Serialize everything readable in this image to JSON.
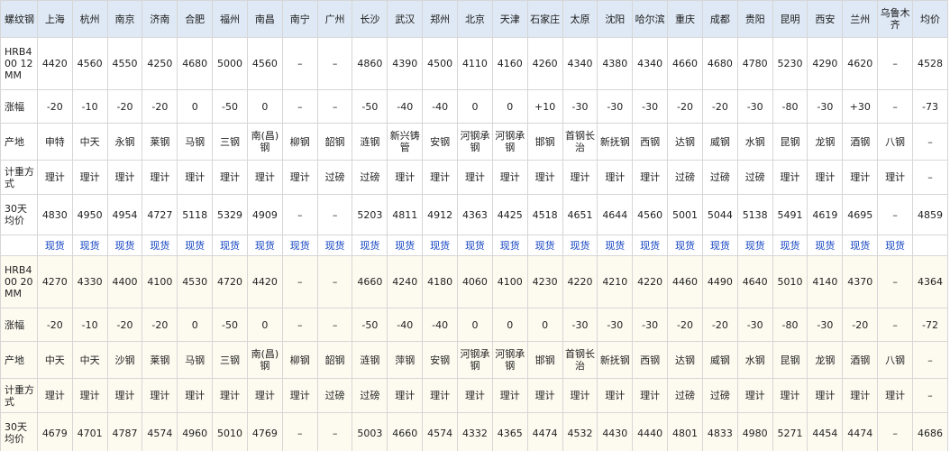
{
  "header": {
    "corner": "螺纹钢",
    "cities": [
      "上海",
      "杭州",
      "南京",
      "济南",
      "合肥",
      "福州",
      "南昌",
      "南宁",
      "广州",
      "长沙",
      "武汉",
      "郑州",
      "北京",
      "天津",
      "石家庄",
      "太原",
      "沈阳",
      "哈尔滨",
      "重庆",
      "成都",
      "贵阳",
      "昆明",
      "西安",
      "兰州",
      "乌鲁木齐"
    ],
    "avg_col": "均价"
  },
  "row_labels": {
    "change": "涨幅",
    "origin": "产地",
    "method": "计重方式",
    "avg30": "30天均价"
  },
  "link_text": "现货",
  "sections": [
    {
      "spec": "HRB400 12MM",
      "prices": [
        "4420",
        "4560",
        "4550",
        "4250",
        "4680",
        "5000",
        "4560",
        "–",
        "–",
        "4860",
        "4390",
        "4500",
        "4110",
        "4160",
        "4260",
        "4340",
        "4380",
        "4340",
        "4660",
        "4680",
        "4780",
        "5230",
        "4290",
        "4620",
        "–",
        "4528"
      ],
      "changes": [
        "-20",
        "-10",
        "-20",
        "-20",
        "0",
        "-50",
        "0",
        "–",
        "–",
        "-50",
        "-40",
        "-40",
        "0",
        "0",
        "+10",
        "-30",
        "-30",
        "-30",
        "-20",
        "-20",
        "-30",
        "-80",
        "-30",
        "+30",
        "–",
        "-73"
      ],
      "origins": [
        "申特",
        "中天",
        "永钢",
        "莱钢",
        "马钢",
        "三钢",
        "南(昌)钢",
        "柳钢",
        "韶钢",
        "涟钢",
        "新兴铸管",
        "安钢",
        "河钢承钢",
        "河钢承钢",
        "邯钢",
        "首钢长治",
        "新抚钢",
        "西钢",
        "达钢",
        "威钢",
        "水钢",
        "昆钢",
        "龙钢",
        "酒钢",
        "八钢",
        "–"
      ],
      "methods": [
        "理计",
        "理计",
        "理计",
        "理计",
        "理计",
        "理计",
        "理计",
        "理计",
        "过磅",
        "过磅",
        "理计",
        "理计",
        "理计",
        "理计",
        "理计",
        "理计",
        "理计",
        "理计",
        "过磅",
        "过磅",
        "过磅",
        "理计",
        "理计",
        "理计",
        "理计",
        "–"
      ],
      "avg30": [
        "4830",
        "4950",
        "4954",
        "4727",
        "5118",
        "5329",
        "4909",
        "–",
        "–",
        "5203",
        "4811",
        "4912",
        "4363",
        "4425",
        "4518",
        "4651",
        "4644",
        "4560",
        "5001",
        "5044",
        "5138",
        "5491",
        "4619",
        "4695",
        "–",
        "4859"
      ]
    },
    {
      "spec": "HRB400 20MM",
      "prices": [
        "4270",
        "4330",
        "4400",
        "4100",
        "4530",
        "4720",
        "4420",
        "–",
        "–",
        "4660",
        "4240",
        "4180",
        "4060",
        "4100",
        "4230",
        "4220",
        "4210",
        "4220",
        "4460",
        "4490",
        "4640",
        "5010",
        "4140",
        "4370",
        "–",
        "4364"
      ],
      "changes": [
        "-20",
        "-10",
        "-20",
        "-20",
        "0",
        "-50",
        "0",
        "–",
        "–",
        "-50",
        "-40",
        "-40",
        "0",
        "0",
        "0",
        "-30",
        "-30",
        "-30",
        "-20",
        "-20",
        "-30",
        "-80",
        "-30",
        "-20",
        "–",
        "-72"
      ],
      "origins": [
        "中天",
        "中天",
        "沙钢",
        "莱钢",
        "马钢",
        "三钢",
        "南(昌)钢",
        "柳钢",
        "韶钢",
        "涟钢",
        "萍钢",
        "安钢",
        "河钢承钢",
        "河钢承钢",
        "邯钢",
        "首钢长治",
        "新抚钢",
        "西钢",
        "达钢",
        "威钢",
        "水钢",
        "昆钢",
        "龙钢",
        "酒钢",
        "八钢",
        "–"
      ],
      "methods": [
        "理计",
        "理计",
        "理计",
        "理计",
        "理计",
        "理计",
        "理计",
        "理计",
        "过磅",
        "过磅",
        "理计",
        "理计",
        "理计",
        "理计",
        "理计",
        "理计",
        "理计",
        "理计",
        "过磅",
        "过磅",
        "理计",
        "理计",
        "理计",
        "理计",
        "理计",
        "–"
      ],
      "avg30": [
        "4679",
        "4701",
        "4787",
        "4574",
        "4960",
        "5010",
        "4769",
        "–",
        "–",
        "5003",
        "4660",
        "4574",
        "4332",
        "4365",
        "4474",
        "4532",
        "4430",
        "4440",
        "4801",
        "4833",
        "4980",
        "5271",
        "4454",
        "4474",
        "–",
        "4686"
      ]
    }
  ]
}
